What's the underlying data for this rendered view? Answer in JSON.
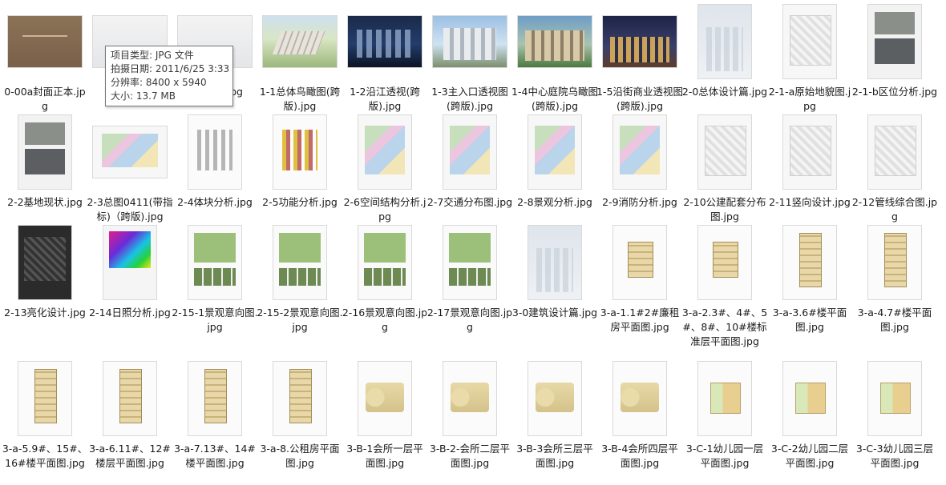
{
  "tooltip": {
    "type": "项目类型: JPG 文件",
    "date": "拍摄日期: 2011/6/25 3:33",
    "resolution": "分辨率: 8400 x 5940",
    "size": "大小: 13.7 MB"
  },
  "files": [
    {
      "name": "0-00a封面正本.jpg",
      "thumb": "cover",
      "shape": "land"
    },
    {
      "name": "0-....jpg",
      "thumb": "light",
      "shape": "land"
    },
    {
      "name": "...(跨版).jpg",
      "thumb": "light",
      "shape": "land"
    },
    {
      "name": "1-1总体鸟瞰图(跨版).jpg",
      "thumb": "aerial",
      "shape": "land"
    },
    {
      "name": "1-2沿江透视(跨版).jpg",
      "thumb": "night",
      "shape": "land"
    },
    {
      "name": "1-3主入口透视图(跨版).jpg",
      "thumb": "day",
      "shape": "land"
    },
    {
      "name": "1-4中心庭院乌瞰图(跨版).jpg",
      "thumb": "court",
      "shape": "land"
    },
    {
      "name": "1-5沿街商业透视图(跨版).jpg",
      "thumb": "street",
      "shape": "land"
    },
    {
      "name": "2-0总体设计篇.jpg",
      "thumb": "haze",
      "shape": "port"
    },
    {
      "name": "2-1-a原始地貌图.jpg",
      "thumb": "plan",
      "shape": "port"
    },
    {
      "name": "2-1-b区位分析.jpg",
      "thumb": "collage",
      "shape": "port"
    },
    {
      "name": "2-2基地现状.jpg",
      "thumb": "collage",
      "shape": "port"
    },
    {
      "name": "2-3总图0411(带指标)（跨版).jpg",
      "thumb": "colorplan",
      "shape": "land"
    },
    {
      "name": "2-4体块分析.jpg",
      "thumb": "block",
      "shape": "port"
    },
    {
      "name": "2-5功能分析.jpg",
      "thumb": "func",
      "shape": "port"
    },
    {
      "name": "2-6空间结构分析.jpg",
      "thumb": "colorplan",
      "shape": "port"
    },
    {
      "name": "2-7交通分布图.jpg",
      "thumb": "colorplan",
      "shape": "port"
    },
    {
      "name": "2-8景观分析.jpg",
      "thumb": "colorplan",
      "shape": "port"
    },
    {
      "name": "2-9消防分析.jpg",
      "thumb": "colorplan",
      "shape": "port"
    },
    {
      "name": "2-10公建配套分布图.jpg",
      "thumb": "plan",
      "shape": "port"
    },
    {
      "name": "2-11竖向设计.jpg",
      "thumb": "plan",
      "shape": "port"
    },
    {
      "name": "2-12管线综合图.jpg",
      "thumb": "plan",
      "shape": "port"
    },
    {
      "name": "2-13亮化设计.jpg",
      "thumb": "dark",
      "shape": "port"
    },
    {
      "name": "2-14日照分析.jpg",
      "thumb": "heat",
      "shape": "port"
    },
    {
      "name": "2-15-1景观意向图.jpg",
      "thumb": "views",
      "shape": "port"
    },
    {
      "name": "2-15-2景观意向图.jpg",
      "thumb": "views",
      "shape": "port"
    },
    {
      "name": "2-16景观意向图.jpg",
      "thumb": "views",
      "shape": "port"
    },
    {
      "name": "2-17景观意向图.jpg",
      "thumb": "views",
      "shape": "port"
    },
    {
      "name": "3-0建筑设计篇.jpg",
      "thumb": "haze",
      "shape": "port"
    },
    {
      "name": "3-a-1.1#2#廉租房平面图.jpg",
      "thumb": "floor",
      "shape": "port"
    },
    {
      "name": "3-a-2.3#、4#、5#、8#、10#楼标准层平面图.jpg",
      "thumb": "floor",
      "shape": "port"
    },
    {
      "name": "3-a-3.6#楼平面图.jpg",
      "thumb": "floortall",
      "shape": "port"
    },
    {
      "name": "3-a-4.7#楼平面图.jpg",
      "thumb": "floortall",
      "shape": "port"
    },
    {
      "name": "3-a-5.9#、15#、16#楼平面图.jpg",
      "thumb": "floortall",
      "shape": "port"
    },
    {
      "name": "3-a-6.11#、12#楼层平面图.jpg",
      "thumb": "floortall",
      "shape": "port"
    },
    {
      "name": "3-a-7.13#、14#楼平面图.jpg",
      "thumb": "floortall",
      "shape": "port"
    },
    {
      "name": "3-a-8.公租房平面图.jpg",
      "thumb": "floortall",
      "shape": "port"
    },
    {
      "name": "3-B-1会所一层平面图.jpg",
      "thumb": "club",
      "shape": "port"
    },
    {
      "name": "3-B-2-会所二层平面图.jpg",
      "thumb": "club",
      "shape": "port"
    },
    {
      "name": "3-B-3会所三层平面图.jpg",
      "thumb": "club",
      "shape": "port"
    },
    {
      "name": "3-B-4会所四层平面图.jpg",
      "thumb": "club",
      "shape": "port"
    },
    {
      "name": "3-C-1幼儿园一层平面图.jpg",
      "thumb": "kinder",
      "shape": "port"
    },
    {
      "name": "3-C-2幼儿园二层平面图.jpg",
      "thumb": "kinder",
      "shape": "port"
    },
    {
      "name": "3-C-3幼儿园三层平面图.jpg",
      "thumb": "kinder",
      "shape": "port"
    }
  ]
}
